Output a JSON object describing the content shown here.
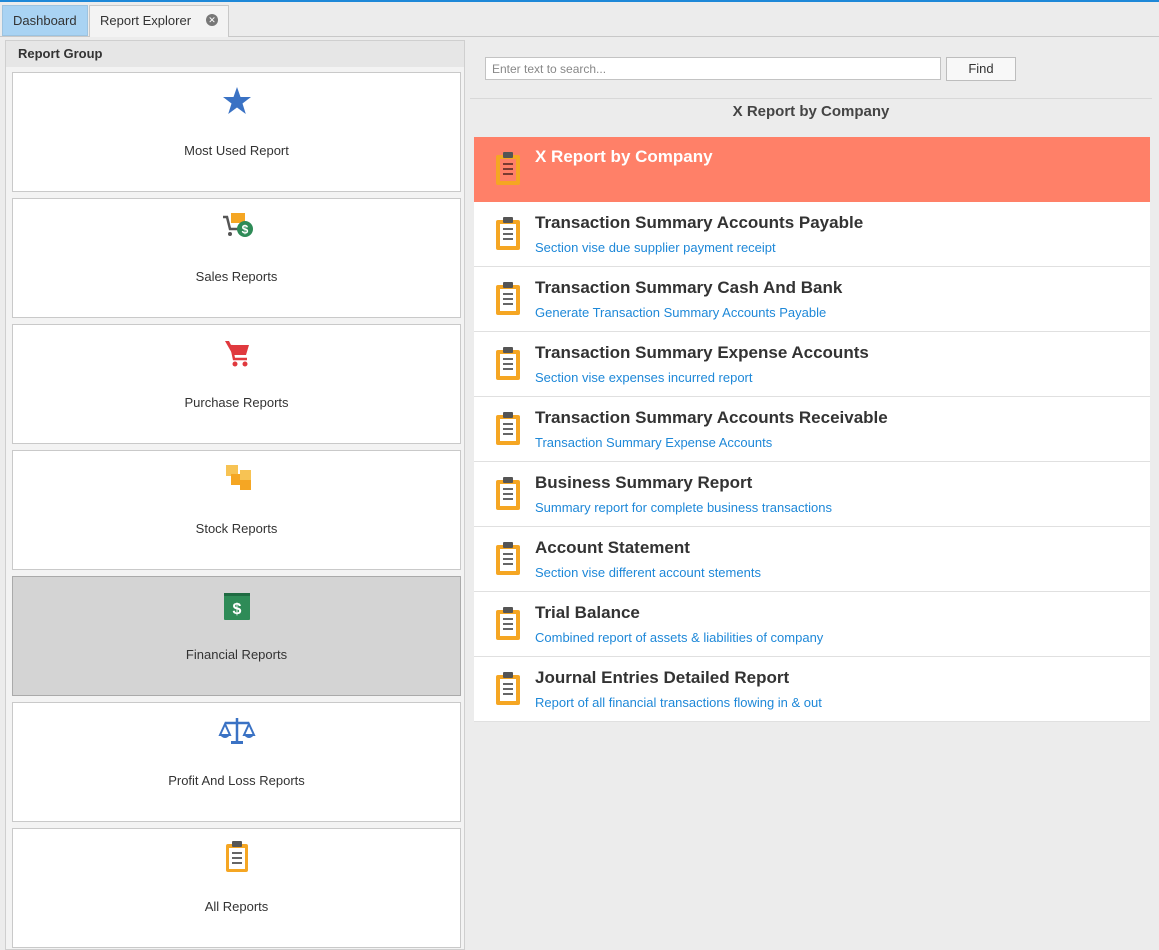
{
  "tabs": [
    {
      "label": "Dashboard"
    },
    {
      "label": "Report Explorer",
      "close_icon": "close-circle-icon"
    }
  ],
  "report_group": {
    "header": "Report Group",
    "items": [
      {
        "label": "Most Used Report",
        "icon": "star-icon"
      },
      {
        "label": "Sales Reports",
        "icon": "cart-dollar-icon"
      },
      {
        "label": "Purchase Reports",
        "icon": "shopping-cart-icon"
      },
      {
        "label": "Stock Reports",
        "icon": "boxes-icon"
      },
      {
        "label": "Financial Reports",
        "icon": "dollar-book-icon",
        "selected": true
      },
      {
        "label": "Profit And Loss Reports",
        "icon": "balance-scale-icon"
      },
      {
        "label": "All Reports",
        "icon": "clipboard-icon"
      }
    ]
  },
  "search": {
    "placeholder": "Enter text to search...",
    "value": "",
    "find_label": "Find"
  },
  "selected_report_title": "X Report by Company",
  "reports": [
    {
      "title": "X Report by Company",
      "description": "",
      "active": true
    },
    {
      "title": "Transaction Summary Accounts Payable",
      "description": "Section vise due supplier payment receipt"
    },
    {
      "title": "Transaction Summary Cash And Bank",
      "description": "Generate Transaction Summary Accounts Payable"
    },
    {
      "title": "Transaction Summary Expense Accounts",
      "description": "Section vise expenses incurred report"
    },
    {
      "title": "Transaction Summary Accounts Receivable",
      "description": "Transaction Summary Expense Accounts"
    },
    {
      "title": "Business Summary Report",
      "description": "Summary report for complete business transactions"
    },
    {
      "title": "Account Statement",
      "description": "Section vise different account stements"
    },
    {
      "title": "Trial Balance",
      "description": "Combined report of assets & liabilities of company"
    },
    {
      "title": "Journal Entries Detailed Report",
      "description": "Report of all financial transactions flowing in & out"
    }
  ],
  "colors": {
    "accent": "#1e88d8",
    "active_report": "#ff8068",
    "clipboard": "#f5a623",
    "selected_group": "#d4d4d4"
  }
}
